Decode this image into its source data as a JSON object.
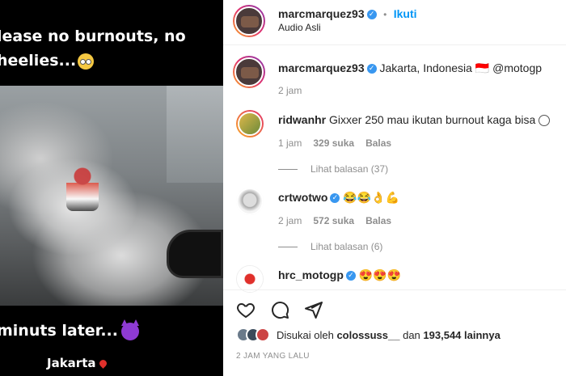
{
  "story": {
    "caption_top_line1": "lease no burnouts, no",
    "caption_top_line2": "heelies...",
    "caption_bottom": "minuts later...",
    "location": "Jakarta"
  },
  "header": {
    "username": "marcmarquez93",
    "separator": "•",
    "follow_label": "Ikuti",
    "audio": "Audio Asli"
  },
  "post": {
    "username": "marcmarquez93",
    "text": "Jakarta, Indonesia 🇮🇩 @motogp",
    "time": "2 jam"
  },
  "comments": [
    {
      "username": "ridwanhr",
      "text": "Gixxer 250 mau ikutan burnout kaga bisa",
      "time": "1 jam",
      "likes": "329 suka",
      "reply_label": "Balas",
      "view_replies": "Lihat balasan (37)"
    },
    {
      "username": "crtwotwo",
      "text": "😂😂👌💪",
      "time": "2 jam",
      "likes": "572 suka",
      "reply_label": "Balas",
      "view_replies": "Lihat balasan (6)"
    },
    {
      "username": "hrc_motogp",
      "text": "😍😍😍"
    }
  ],
  "likes_text_prefix": "Disukai oleh ",
  "likes_user": "colossuss__",
  "likes_text_mid": " dan ",
  "likes_count": "193,544",
  "likes_text_suffix": " lainnya",
  "timestamp": "2 JAM YANG LALU",
  "colors": {
    "accent": "#0095f6",
    "verified": "#3897f0",
    "text": "#262626",
    "muted": "#8e8e8e"
  }
}
